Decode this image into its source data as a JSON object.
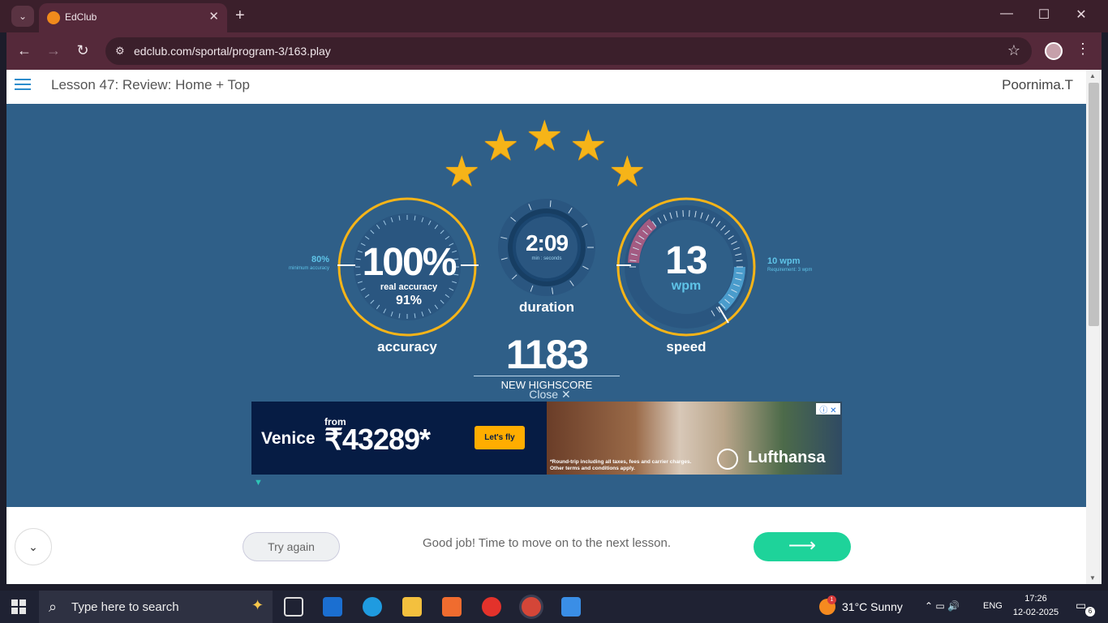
{
  "browser": {
    "tab_title": "EdClub",
    "url": "edclub.com/sportal/program-3/163.play"
  },
  "page": {
    "lesson_title": "Lesson 47: Review: Home + Top",
    "username": "Poornima.T",
    "stars": 5
  },
  "accuracy": {
    "value": "100%",
    "sub_label": "real accuracy",
    "real_value": "91%",
    "label": "accuracy",
    "min_value": "80%",
    "min_label": "minimum accuracy",
    "percent": 100
  },
  "duration": {
    "value": "2:09",
    "sub_label": "min : seconds",
    "label": "duration"
  },
  "speed": {
    "value": "13",
    "unit": "wpm",
    "label": "speed",
    "req_value": "10 wpm",
    "req_label": "Requirement: 3 wpm"
  },
  "score": {
    "value": "1183",
    "label": "NEW HIGHSCORE"
  },
  "ad": {
    "close_label": "Close ✕",
    "city": "Venice",
    "from": "from",
    "price": "₹43289*",
    "cta": "Let's fly",
    "fine_print_1": "*Round-trip including all taxes, fees and carrier charges.",
    "fine_print_2": "Other terms and conditions apply.",
    "brand": "Lufthansa",
    "choices": "ⓘ ✕"
  },
  "bottom": {
    "try_again": "Try again",
    "message": "Good job! Time to move on to the next lesson.",
    "next_arrow": "⟶"
  },
  "taskbar": {
    "search_placeholder": "Type here to search",
    "weather": "31°C  Sunny",
    "weather_badge": "1",
    "language": "ENG",
    "time": "17:26",
    "date": "12-02-2025",
    "notification_count": "6"
  },
  "colors": {
    "page_bg": "#2f5f88",
    "gold": "#f6b418",
    "accent_blue": "#5fc4e8",
    "next_button": "#1ed39a"
  }
}
